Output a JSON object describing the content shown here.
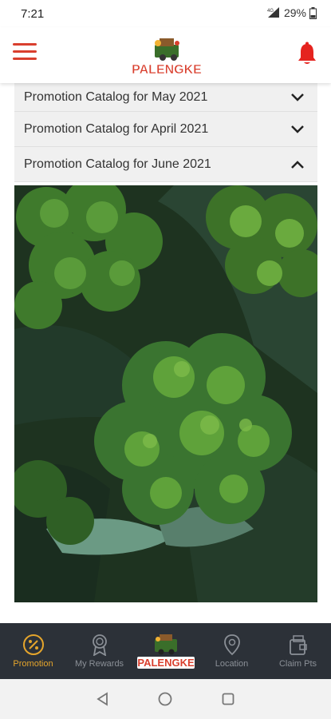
{
  "status_bar": {
    "time": "7:21",
    "network": "4G",
    "battery": "29%"
  },
  "header": {
    "logo_text": "PALENGKE",
    "menu_icon": "hamburger-menu-icon",
    "notification_icon": "bell-icon",
    "accent_color": "#d93f2e"
  },
  "accordion": {
    "items": [
      {
        "label": "Promotion Catalog for May 2021",
        "expanded": false
      },
      {
        "label": "Promotion Catalog for April 2021",
        "expanded": false
      },
      {
        "label": "Promotion Catalog for June 2021",
        "expanded": true
      }
    ]
  },
  "bottom_nav": {
    "items": [
      {
        "label": "Promotion",
        "icon": "percent-badge-icon",
        "active": true
      },
      {
        "label": "My Rewards",
        "icon": "medal-icon",
        "active": false
      },
      {
        "label": "",
        "icon": "palengke-logo",
        "active": false
      },
      {
        "label": "Location",
        "icon": "location-pin-icon",
        "active": false
      },
      {
        "label": "Claim Pts",
        "icon": "wallet-icon",
        "active": false
      }
    ],
    "active_color": "#e5a52c",
    "logo_text": "PALENGKE"
  },
  "system_nav": {
    "back": "back-icon",
    "home": "home-icon",
    "recents": "recents-icon"
  }
}
